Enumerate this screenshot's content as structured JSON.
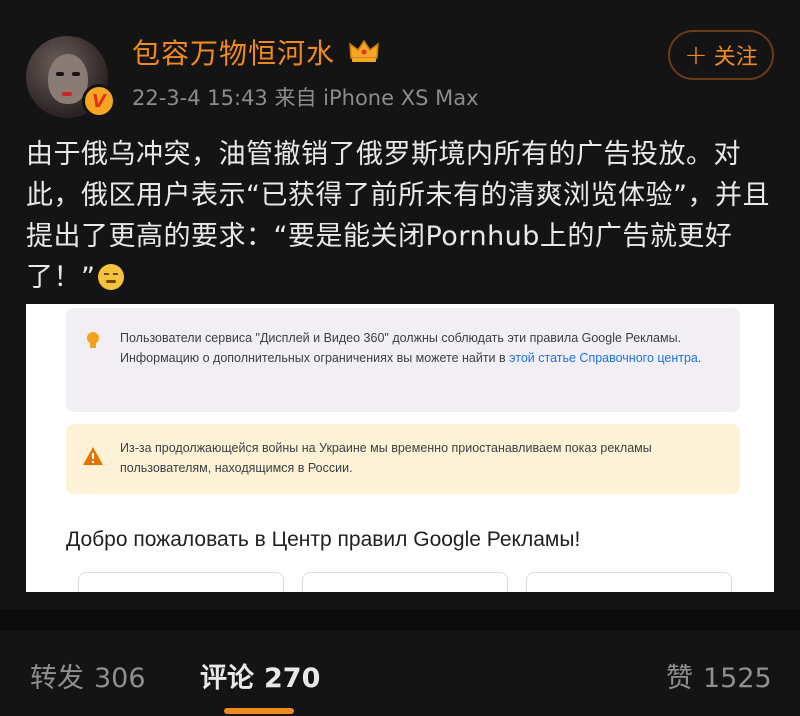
{
  "post": {
    "author": "包容万物恒河水",
    "meta": "22-3-4 15:43  来自 iPhone XS Max",
    "follow_label": "关注",
    "text": "由于俄乌冲突，油管撤销了俄罗斯境内所有的广告投放。对此，俄区用户表示“已获得了前所未有的清爽浏览体验”，并且提出了更高的要求：“要是能关闭Pornhub上的广告就更好了！”",
    "icons": {
      "avatar": "avatar",
      "verified": "verified-v-badge",
      "vip": "crown-icon",
      "emoji": "smirk-emoji"
    },
    "accent_color": "#f08a1f"
  },
  "embedded_screenshot": {
    "info_notice_text": "Пользователи сервиса \"Дисплей и Видео 360\" должны соблюдать эти правила Google Рекламы. Информацию о дополнительных ограничениях вы можете найти в ",
    "info_notice_link": "этой статье Справочного центра",
    "info_notice_end": ".",
    "warning_text": "Из-за продолжающейся войны на Украине мы временно приостанавливаем показ рекламы пользователям, находящимся в России.",
    "welcome_heading": "Добро пожаловать в Центр правил Google Рекламы!"
  },
  "actions": {
    "repost_label": "转发",
    "repost_count": "306",
    "comment_label": "评论",
    "comment_count": "270",
    "like_label": "赞",
    "like_count": "1525"
  }
}
